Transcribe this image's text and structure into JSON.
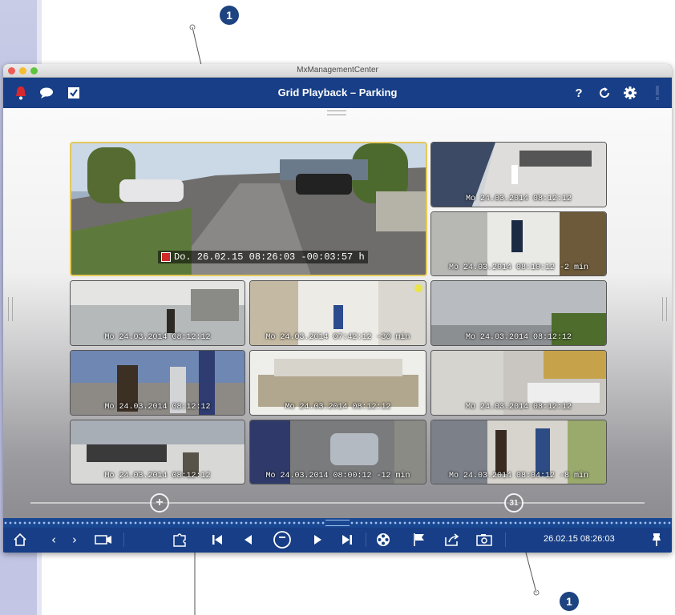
{
  "callouts": {
    "top": "1",
    "bottom": "1"
  },
  "window": {
    "title": "MxManagementCenter",
    "traffic_lights": [
      "#ee5c55",
      "#f5bc32",
      "#5ec440"
    ]
  },
  "appbar": {
    "title": "Grid Playback – Parking",
    "left_icons": [
      "alarm-bell-icon",
      "chat-bubble-icon",
      "checkbox-icon"
    ],
    "help_label": "?",
    "right_icons": [
      "help-icon",
      "refresh-icon",
      "settings-gear-icon",
      "alarm-indicator-icon"
    ]
  },
  "grid": {
    "main": {
      "timestamp": "Do. 26.02.15 08:26:03 -00:03:57 h"
    },
    "tiles": [
      {
        "id": "r1",
        "timestamp": "Mo 24.03.2014  08:12:12"
      },
      {
        "id": "r2",
        "timestamp": "Mo 24.03.2014 08:10:12  -2 min"
      },
      {
        "id": "a1",
        "timestamp": "Mo 24.03.2014  08:12:12"
      },
      {
        "id": "a2",
        "timestamp": "Mo 24.03.2014 07:42:12  -30 min"
      },
      {
        "id": "a3",
        "timestamp": "Mo 24.03.2014  08:12:12"
      },
      {
        "id": "b1",
        "timestamp": "Mo 24.03.2014  08:12:12"
      },
      {
        "id": "b2",
        "timestamp": "Mo 24.03.2014  08:12:12"
      },
      {
        "id": "b3",
        "timestamp": "Mo 24.03.2014  08:12:12"
      },
      {
        "id": "c1",
        "timestamp": "Mo 24.03.2014  08:12:12"
      },
      {
        "id": "c2",
        "timestamp": "Mo 24.03.2014 08:00:12  -12 min"
      },
      {
        "id": "c3",
        "timestamp": "Mo 24.03.2014 08:04:12  -8 min"
      }
    ]
  },
  "timeline": {
    "add_label": "+",
    "calendar_label": "31"
  },
  "toolbar": {
    "icons": [
      "home-icon",
      "back-icon",
      "forward-icon",
      "camera-icon",
      "puzzle-icon",
      "skip-first-icon",
      "step-back-icon",
      "pause-record-icon",
      "step-forward-icon",
      "skip-last-icon",
      "film-reel-icon",
      "flag-icon",
      "export-icon",
      "snapshot-icon",
      "pin-icon"
    ],
    "datetime": "26.02.15 08:26:03"
  }
}
